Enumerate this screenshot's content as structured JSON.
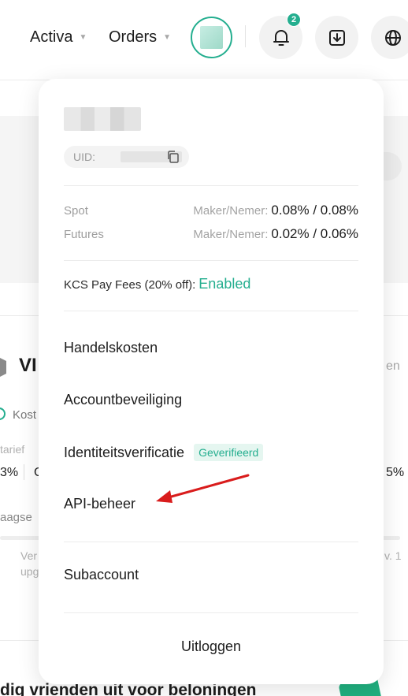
{
  "topbar": {
    "assets_label": "Activa",
    "orders_label": "Orders",
    "notification_count": "2"
  },
  "background": {
    "vip_heading": "VI",
    "cost_partial": "Kost",
    "tarief_partial": "tarief",
    "pct_left": "3%",
    "pct_left2": "C",
    "pct_right": "5%",
    "right_partial": "en",
    "aagse_partial": "aagse",
    "ver_partial": "Ver",
    "upg_partial": "upg",
    "right_small": "v. 1",
    "promo_text": "dig vrienden uit voor beloningen"
  },
  "account": {
    "uid_label": "UID:"
  },
  "fees": [
    {
      "market": "Spot",
      "key": "Maker/Nemer:",
      "value": "0.08% / 0.08%"
    },
    {
      "market": "Futures",
      "key": "Maker/Nemer:",
      "value": "0.02% / 0.06%"
    }
  ],
  "kcs": {
    "label": "KCS Pay Fees (20% off):",
    "status": "Enabled"
  },
  "menu": {
    "trading_fees": "Handelskosten",
    "security": "Accountbeveiliging",
    "identity": "Identiteitsverificatie",
    "identity_badge": "Geverifieerd",
    "api": "API-beheer",
    "subaccount": "Subaccount",
    "logout": "Uitloggen"
  },
  "colors": {
    "accent": "#24ae8f",
    "annotation_arrow": "#d91c1c"
  }
}
